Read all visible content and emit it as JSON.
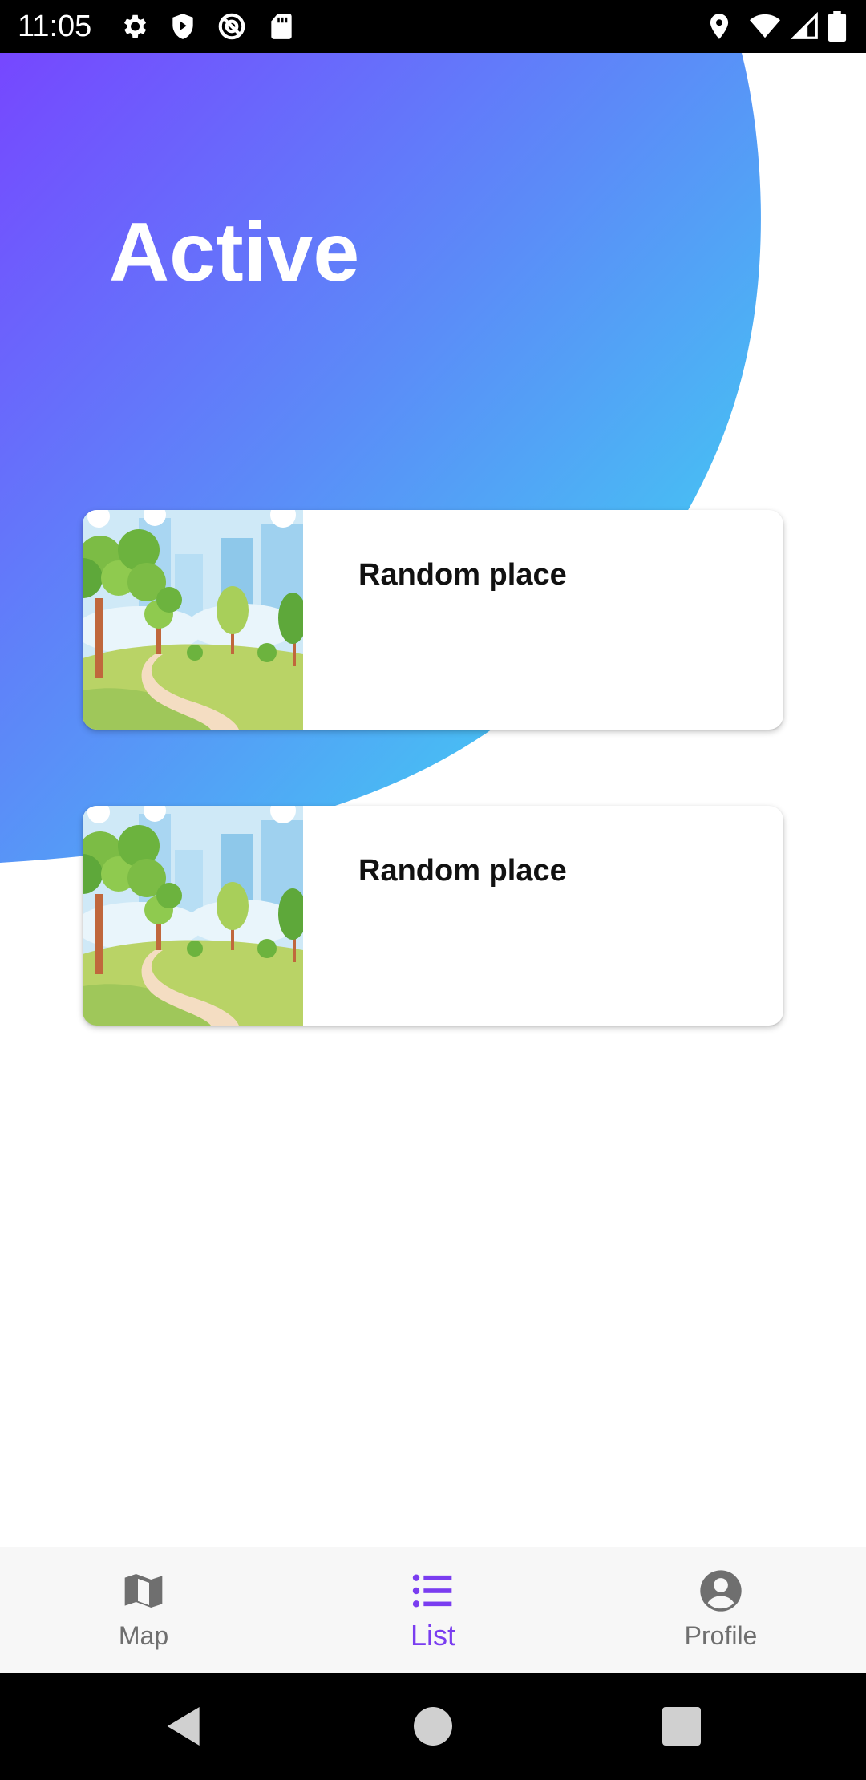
{
  "status_bar": {
    "time": "11:05",
    "icons_left": [
      "settings-icon",
      "shield-icon",
      "vpn-icon",
      "sd-card-icon"
    ],
    "icons_right": [
      "location-icon",
      "wifi-icon",
      "signal-icon",
      "battery-icon"
    ]
  },
  "header": {
    "title": "Active"
  },
  "places": [
    {
      "title": "Random place",
      "image": "park-illustration"
    },
    {
      "title": "Random place",
      "image": "park-illustration"
    }
  ],
  "bottom_nav": {
    "items": [
      {
        "label": "Map",
        "icon": "map-icon",
        "active": false
      },
      {
        "label": "List",
        "icon": "list-icon",
        "active": true
      },
      {
        "label": "Profile",
        "icon": "account-circle-icon",
        "active": false
      }
    ]
  },
  "colors": {
    "accent": "#7a3df0",
    "gradient_start": "#7647ff",
    "gradient_end": "#38e6f0",
    "inactive_nav": "#6f6f6f"
  }
}
